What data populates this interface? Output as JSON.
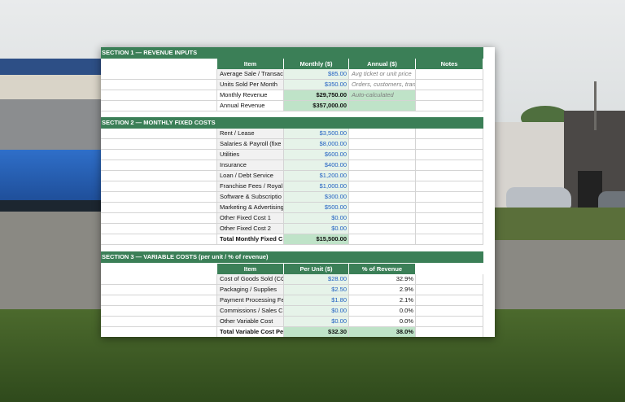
{
  "colors": {
    "section_header": "#3b7f57",
    "input_value": "#1f5fc2",
    "calc_fill": "#bfe3c8",
    "input_fill": "#e6f3e9"
  },
  "section1": {
    "title": "SECTION 1 — REVENUE INPUTS",
    "headers": [
      "Item",
      "Monthly ($)",
      "Annual ($)",
      "Notes"
    ],
    "rows": [
      {
        "item": "Average Sale / Transac",
        "monthly": "$85.00",
        "annual": "Avg ticket or unit price"
      },
      {
        "item": "Units Sold Per Month",
        "monthly": "$350.00",
        "annual": "Orders, customers, transactions"
      },
      {
        "item": "Monthly Revenue",
        "monthly": "$29,750.00",
        "annual": "Auto-calculated"
      },
      {
        "item": "Annual Revenue",
        "monthly": "$357,000.00",
        "annual": ""
      }
    ]
  },
  "section2": {
    "title": "SECTION 2 — MONTHLY FIXED COSTS",
    "rows": [
      {
        "item": "Rent / Lease",
        "value": "$3,500.00"
      },
      {
        "item": "Salaries & Payroll (fixe",
        "value": "$8,000.00"
      },
      {
        "item": "Utilities",
        "value": "$600.00"
      },
      {
        "item": "Insurance",
        "value": "$400.00"
      },
      {
        "item": "Loan / Debt Service",
        "value": "$1,200.00"
      },
      {
        "item": "Franchise Fees / Royal",
        "value": "$1,000.00"
      },
      {
        "item": "Software & Subscriptio",
        "value": "$300.00"
      },
      {
        "item": "Marketing & Advertising",
        "value": "$500.00"
      },
      {
        "item": "Other Fixed Cost 1",
        "value": "$0.00"
      },
      {
        "item": "Other Fixed Cost 2",
        "value": "$0.00"
      },
      {
        "item": "Total Monthly Fixed C",
        "value": "$15,500.00"
      }
    ]
  },
  "section3": {
    "title": "SECTION 3 — VARIABLE COSTS (per unit / % of revenue)",
    "headers": [
      "Item",
      "Per Unit ($)",
      "% of Revenue"
    ],
    "rows": [
      {
        "item": "Cost of Goods Sold (CC",
        "per_unit": "$28.00",
        "pct": "32.9%"
      },
      {
        "item": "Packaging / Supplies",
        "per_unit": "$2.50",
        "pct": "2.9%"
      },
      {
        "item": "Payment Processing Fe",
        "per_unit": "$1.80",
        "pct": "2.1%"
      },
      {
        "item": "Commissions / Sales C",
        "per_unit": "$0.00",
        "pct": "0.0%"
      },
      {
        "item": "Other Variable Cost",
        "per_unit": "$0.00",
        "pct": "0.0%"
      },
      {
        "item": "Total Variable Cost Pe",
        "per_unit": "$32.30",
        "pct": "38.0%"
      }
    ]
  }
}
